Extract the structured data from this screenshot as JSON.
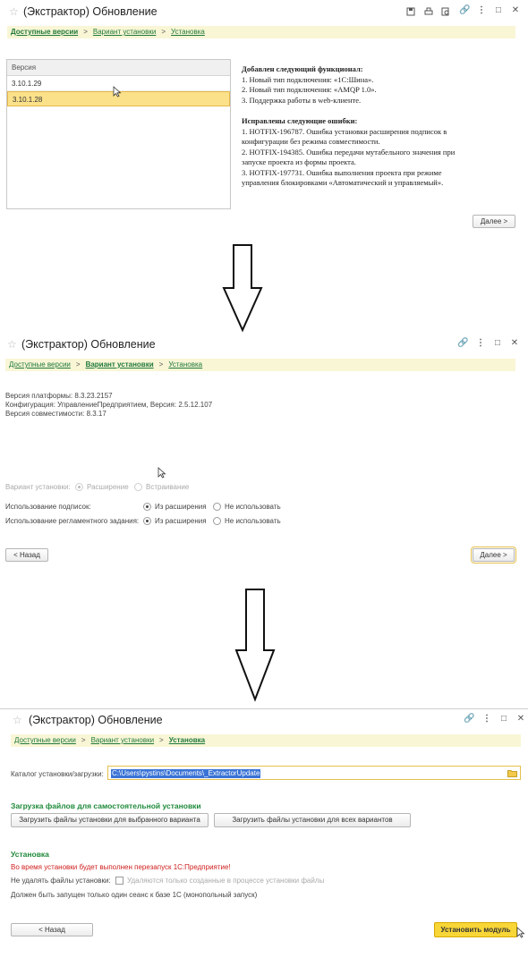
{
  "app_title": "(Экстрактор) Обновление",
  "breadcrumb": {
    "step1": "Доступные версии",
    "step2": "Вариант установки",
    "step3": "Установка",
    "separator": ">"
  },
  "panel1": {
    "version_header": "Версия",
    "versions": [
      "3.10.1.29",
      "3.10.1.28"
    ],
    "selected_version": "3.10.1.28",
    "notes": {
      "added_title": "Добавлен следующий функционал:",
      "added": [
        "1. Новый тип подключения: «1С:Шина».",
        "2. Новый тип подключения: «AMQP 1.0».",
        "3. Поддержка работы в web-клиенте."
      ],
      "fixed_title": "Исправлены следующие ошибки:",
      "fixed": [
        "1. HOTFIX-196787. Ошибка установки расширения подписок в",
        "конфигурации без режима совместимости.",
        "2. HOTFIX-194385. Ошибка передачи мутабельного значения при",
        "запуске проекта из формы проекта.",
        "3. HOTFIX-197731. Ошибка выполнения проекта при режиме",
        "управления блокировками «Автоматический и управляемый»."
      ]
    },
    "next_label": "Далее >"
  },
  "panel2": {
    "platform_version": "Версия платформы: 8.3.23.2157",
    "configuration": "Конфигурация: УправлениеПредприятием, Версия: 2.5.12.107",
    "compat_version": "Версия совместимости: 8.3.17",
    "install_variant_label": "Вариант установки:",
    "variant_extension": "Расширение",
    "variant_embed": "Встраивание",
    "subscriptions_label": "Использование подписок:",
    "scheduled_label": "Использование регламентного задания:",
    "from_extension": "Из расширения",
    "not_use": "Не использовать",
    "back_label": "< Назад",
    "next_label": "Далее >"
  },
  "panel3": {
    "catalog_label": "Каталог установки/загрузки:",
    "catalog_value": "C:\\Users\\pystins\\Documents\\_ExtractorUpdate",
    "download_section": "Загрузка файлов для самостоятельной установки",
    "download_selected": "Загрузить файлы установки для выбранного варианта",
    "download_all": "Загрузить файлы установки для всех вариантов",
    "install_section": "Установка",
    "restart_warning": "Во время установки будет выполнен перезапуск 1С:Предприятие!",
    "keep_files_label": "Не удалять файлы установки:",
    "keep_files_hint": "Удаляются только созданные в процессе установки файлы",
    "single_session_note": "Должен быть запущен только один сеанс к базе 1С (монопольный запуск)",
    "back_label": "< Назад",
    "install_label": "Установить модуль"
  },
  "colors": {
    "accent_yellow": "#f8d637",
    "link_green": "#1f7a3a",
    "warning_red": "#d01e1e",
    "selection_yellow": "#fbe18a"
  }
}
